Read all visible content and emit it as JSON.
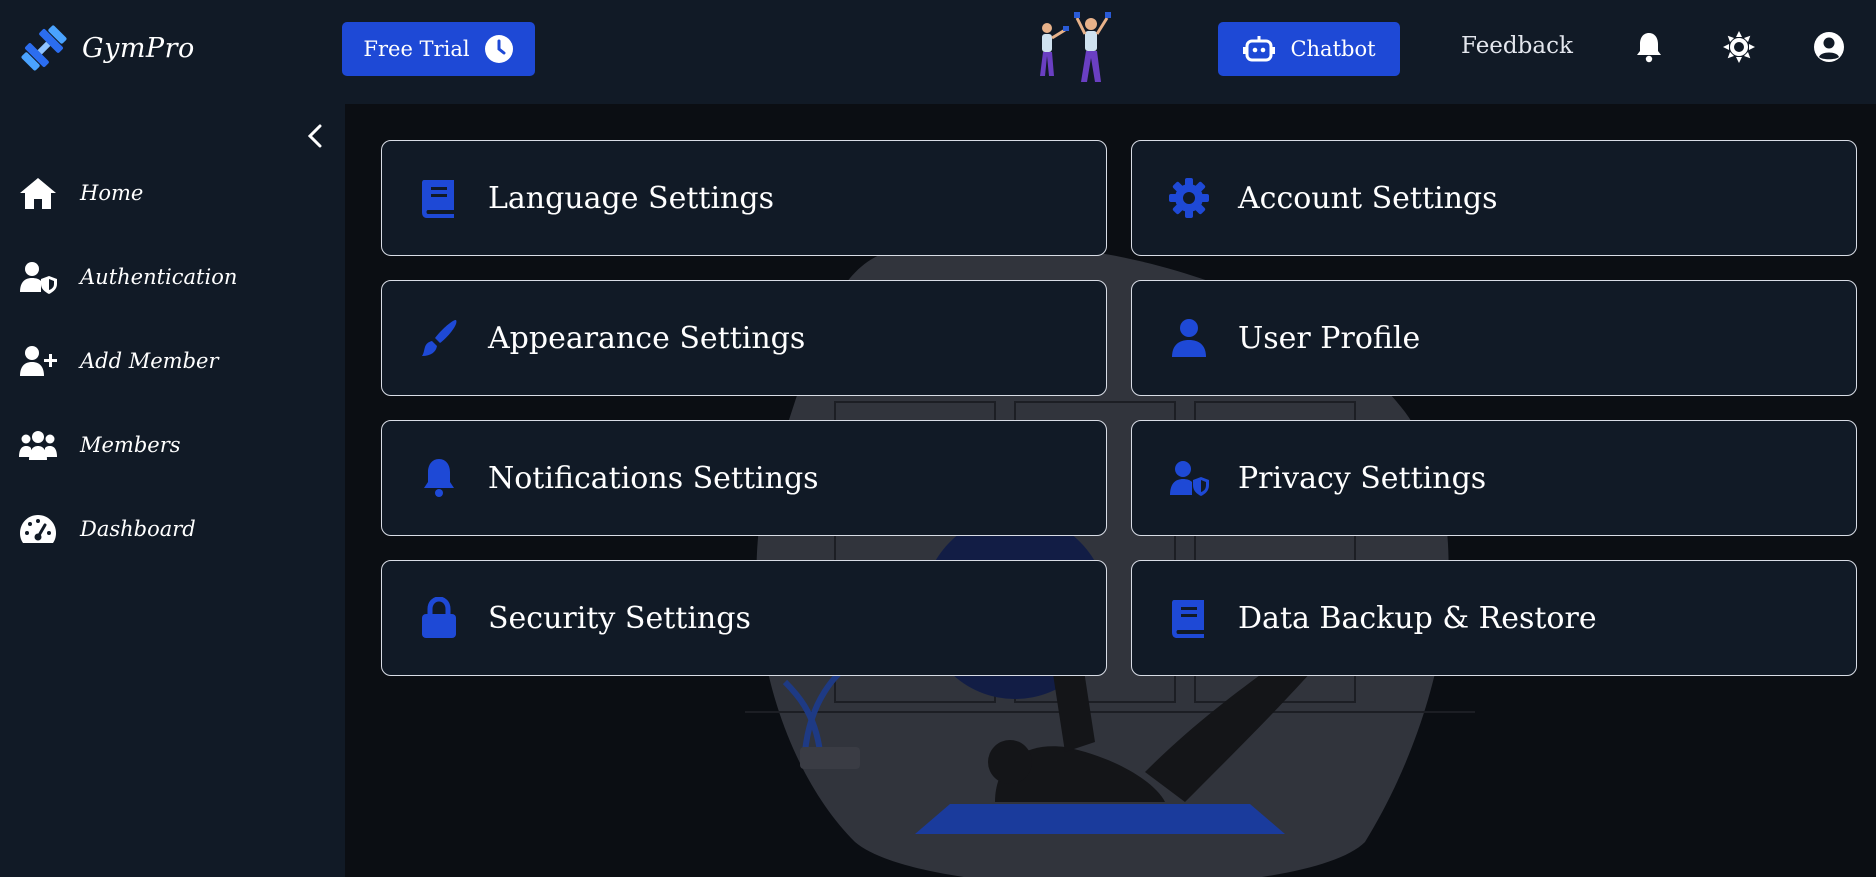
{
  "app": {
    "name": "GymPro"
  },
  "header": {
    "free_trial_label": "Free Trial",
    "chatbot_label": "Chatbot",
    "feedback_label": "Feedback",
    "icons": [
      "bell-icon",
      "sun-icon",
      "user-circle-icon"
    ]
  },
  "sidebar": {
    "items": [
      {
        "label": "Home",
        "icon": "home-icon"
      },
      {
        "label": "Authentication",
        "icon": "user-shield-icon"
      },
      {
        "label": "Add Member",
        "icon": "user-plus-icon"
      },
      {
        "label": "Members",
        "icon": "users-icon"
      },
      {
        "label": "Dashboard",
        "icon": "gauge-icon"
      }
    ]
  },
  "settings": {
    "cards": [
      {
        "label": "Language Settings",
        "icon": "book-icon"
      },
      {
        "label": "Account Settings",
        "icon": "gear-icon"
      },
      {
        "label": "Appearance Settings",
        "icon": "paintbrush-icon"
      },
      {
        "label": "User Profile",
        "icon": "user-icon"
      },
      {
        "label": "Notifications Settings",
        "icon": "bell-icon"
      },
      {
        "label": "Privacy Settings",
        "icon": "user-shield-icon"
      },
      {
        "label": "Security Settings",
        "icon": "lock-icon"
      },
      {
        "label": "Data Backup & Restore",
        "icon": "book-icon"
      }
    ]
  },
  "colors": {
    "accent": "#1e49d6",
    "surface": "#111a26",
    "background": "#0b0e13",
    "border": "#d9dde6"
  }
}
